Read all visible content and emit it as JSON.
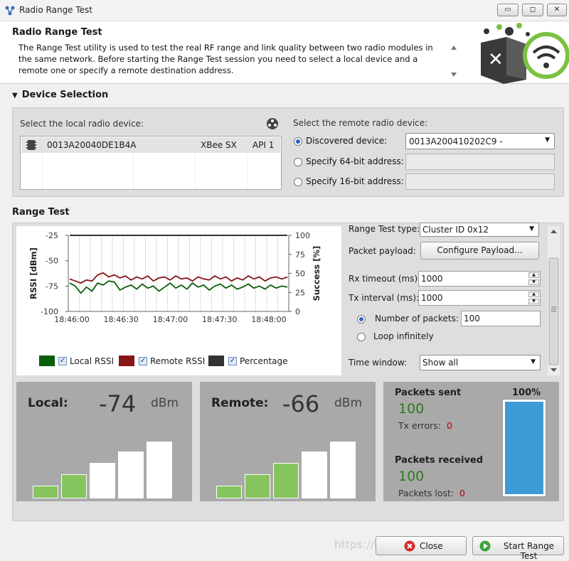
{
  "window": {
    "title": "Radio Range Test",
    "btn_min": "▭",
    "btn_max": "◻",
    "btn_close": "✕"
  },
  "header": {
    "title": "Radio Range Test",
    "description": "The Range Test utility is used to test the real RF range and link quality between two radio modules in the same network. Before starting the Range Test session you need to select a local device and a remote one or specify a remote destination address."
  },
  "device_selection": {
    "title": "Device Selection",
    "local_label": "Select the local radio device:",
    "local_devices": [
      {
        "address": "0013A20040DE1B4A",
        "type": "XBee SX",
        "protocol": "API 1"
      }
    ],
    "remote_label": "Select the remote radio device:",
    "options": {
      "discovered": {
        "label": "Discovered device:",
        "value": "0013A200410202C9 -",
        "selected": true
      },
      "addr64": {
        "label": "Specify 64-bit address:",
        "value": ""
      },
      "addr16": {
        "label": "Specify 16-bit address:",
        "value": ""
      }
    }
  },
  "range_test": {
    "title": "Range Test",
    "controls": {
      "type_label": "Range Test type:",
      "type_value": "Cluster ID 0x12",
      "payload_label": "Packet payload:",
      "configure_payload": "Configure Payload...",
      "rx_timeout_label": "Rx timeout (ms):",
      "rx_timeout_value": "1000",
      "tx_interval_label": "Tx interval (ms):",
      "tx_interval_value": "1000",
      "num_packets_label": "Number of packets:",
      "num_packets_value": "100",
      "loop_label": "Loop infinitely",
      "time_window_label": "Time window:",
      "time_window_value": "Show all"
    },
    "legend": [
      {
        "name": "Local RSSI",
        "color": "#0b5e0b"
      },
      {
        "name": "Remote RSSI",
        "color": "#861616"
      },
      {
        "name": "Percentage",
        "color": "#333333"
      }
    ],
    "check_mark": "✓",
    "axis": {
      "ylabel": "RSSI [dBm]",
      "y2label": "Success [%]"
    }
  },
  "chart_data": {
    "type": "line",
    "ylabel": "RSSI [dBm]",
    "y2label": "Success [%]",
    "ylim": [
      -100,
      -25
    ],
    "y2lim": [
      0,
      100
    ],
    "yticks": [
      "-25",
      "-50",
      "-75",
      "-100"
    ],
    "y2ticks": [
      "100",
      "75",
      "50",
      "25",
      "0"
    ],
    "xticks": [
      "18:46:00",
      "18:46:30",
      "18:47:00",
      "18:47:30",
      "18:48:00"
    ],
    "x_seconds": [
      0,
      30,
      60,
      90,
      120
    ],
    "series": [
      {
        "name": "Local RSSI",
        "color": "#0b5e0b",
        "axis": "left",
        "values": [
          -72,
          -75,
          -82,
          -76,
          -80,
          -72,
          -74,
          -70,
          -71,
          -79,
          -76,
          -74,
          -78,
          -73,
          -77,
          -75,
          -80,
          -76,
          -72,
          -77,
          -74,
          -78,
          -72,
          -76,
          -74,
          -79,
          -75,
          -73,
          -77,
          -74,
          -78,
          -76,
          -73,
          -77,
          -75,
          -78,
          -74,
          -77,
          -75,
          -76
        ]
      },
      {
        "name": "Remote RSSI",
        "color": "#861616",
        "axis": "left",
        "values": [
          -68,
          -70,
          -72,
          -69,
          -70,
          -64,
          -62,
          -66,
          -64,
          -67,
          -65,
          -69,
          -66,
          -68,
          -65,
          -70,
          -67,
          -66,
          -69,
          -65,
          -68,
          -67,
          -70,
          -66,
          -68,
          -69,
          -65,
          -68,
          -66,
          -70,
          -67,
          -69,
          -65,
          -68,
          -66,
          -70,
          -67,
          -66,
          -68,
          -66
        ]
      },
      {
        "name": "Percentage",
        "color": "#333333",
        "axis": "right",
        "values": [
          100,
          100,
          100,
          100,
          100,
          100,
          100,
          100,
          100,
          100,
          100,
          100,
          100,
          100,
          100,
          100,
          100,
          100,
          100,
          100,
          100,
          100,
          100,
          100,
          100,
          100,
          100,
          100,
          100,
          100,
          100,
          100,
          100,
          100,
          100,
          100,
          100,
          100,
          100,
          100
        ]
      }
    ],
    "grid": true,
    "legend_position": "bottom"
  },
  "local": {
    "label": "Local:",
    "value": "-74",
    "unit": "dBm",
    "bars_on": 2
  },
  "remote": {
    "label": "Remote:",
    "value": "-66",
    "unit": "dBm",
    "bars_on": 3
  },
  "packets": {
    "sent_label": "Packets sent",
    "sent_value": "100",
    "tx_errors_label": "Tx errors:",
    "tx_errors_value": "0",
    "received_label": "Packets received",
    "received_value": "100",
    "lost_label": "Packets lost:",
    "lost_value": "0",
    "percent_label": "100%",
    "percent": 100
  },
  "buttons": {
    "close": "Close",
    "start": "Start Range Test"
  },
  "watermark": "https://blog.csdn.net/..."
}
